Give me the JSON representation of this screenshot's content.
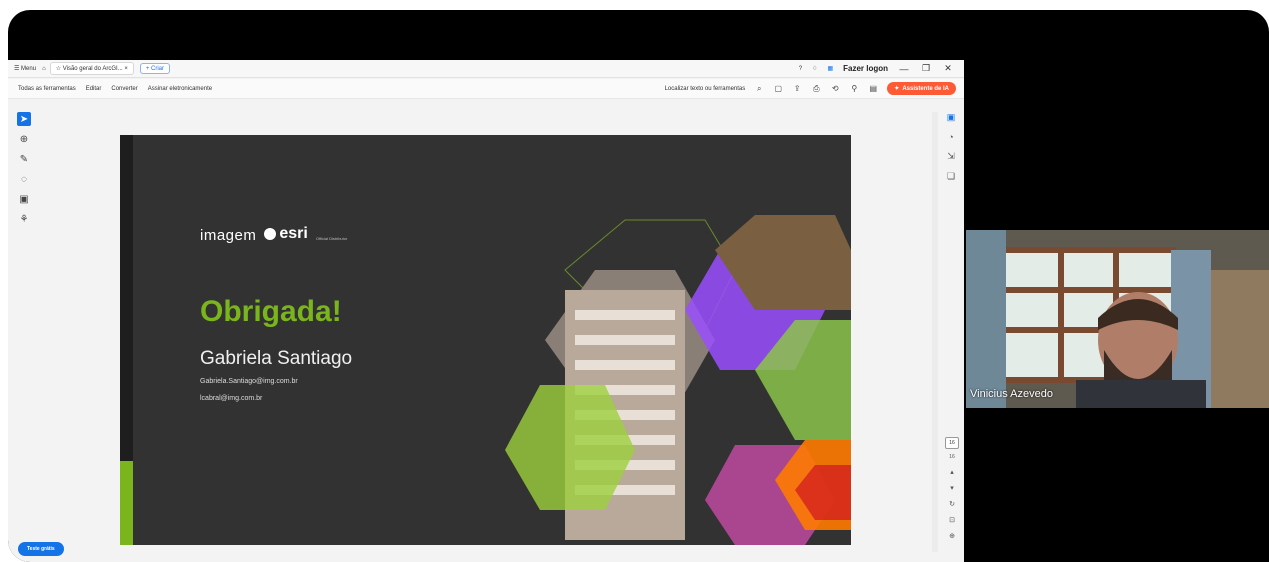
{
  "titlebar": {
    "menu_label": "Menu",
    "tab_title": "Visão geral do ArcGI...",
    "new_tab_label": "Criar",
    "login_label": "Fazer logon"
  },
  "menubar": {
    "items": [
      "Todas as ferramentas",
      "Editar",
      "Converter",
      "Assinar eletronicamente"
    ],
    "search_label": "Localizar texto ou ferramentas",
    "ai_button": "Assistente de IA"
  },
  "slide": {
    "logo_text": "imagem",
    "logo_esri": "esri",
    "logo_small": "Official Distributor",
    "headline": "Obrigada!",
    "name": "Gabriela Santiago",
    "email1": "Gabriela.Santiago@img.com.br",
    "email2": "lcabral@img.com.br",
    "colors": {
      "background": "#323232",
      "accent": "#7ab51d",
      "purple": "#9a4dff"
    }
  },
  "pager": {
    "current": "16",
    "total": "16"
  },
  "free_trial_button": "Teste grátis",
  "video": {
    "participant_name": "Vinicius Azevedo"
  },
  "icons": [
    "home-icon",
    "star-icon",
    "close-icon",
    "help-icon",
    "bell-icon",
    "search-icon",
    "select-arrow-icon",
    "zoom-icon",
    "pen-icon",
    "lasso-icon",
    "crop-icon",
    "stamp-icon"
  ]
}
